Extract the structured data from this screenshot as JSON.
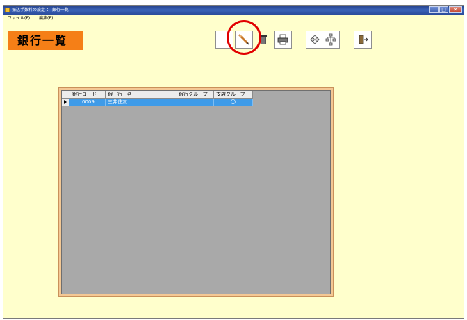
{
  "window": {
    "title": "振込手数料の設定 ： 銀行一覧",
    "controls": {
      "minimize": "–",
      "maximize": "□",
      "close": "✕"
    }
  },
  "menu": [
    {
      "label": "ファイル(F)"
    },
    {
      "label": "編集(E)"
    }
  ],
  "heading": "銀行一覧",
  "toolbar": {
    "buttons": [
      {
        "name": "new-button",
        "icon": "blank-page-icon"
      },
      {
        "name": "edit-button",
        "icon": "pencil-icon",
        "highlighted": true
      },
      {
        "name": "delete-button",
        "icon": "trash-can-icon"
      },
      {
        "name": "print-button",
        "icon": "printer-icon"
      },
      {
        "name": "search-button",
        "icon": "binoculars-icon"
      },
      {
        "name": "tree-button",
        "icon": "hierarchy-icon"
      },
      {
        "name": "exit-button",
        "icon": "exit-door-icon"
      }
    ]
  },
  "table": {
    "columns": [
      "銀行コード",
      "銀　行　名",
      "銀行グループ",
      "支店グループ"
    ],
    "rows": [
      {
        "code": "0009",
        "name": "三井住友",
        "bank_group": "",
        "branch_group": "〇",
        "selected": true
      }
    ]
  },
  "colors": {
    "background": "#ffffcc",
    "heading_bg": "#f57f17",
    "grid_frame": "#f4c894",
    "grid_bg": "#a9a9a9",
    "selected_row": "#3f9be8",
    "highlight_circle": "#e10000"
  }
}
